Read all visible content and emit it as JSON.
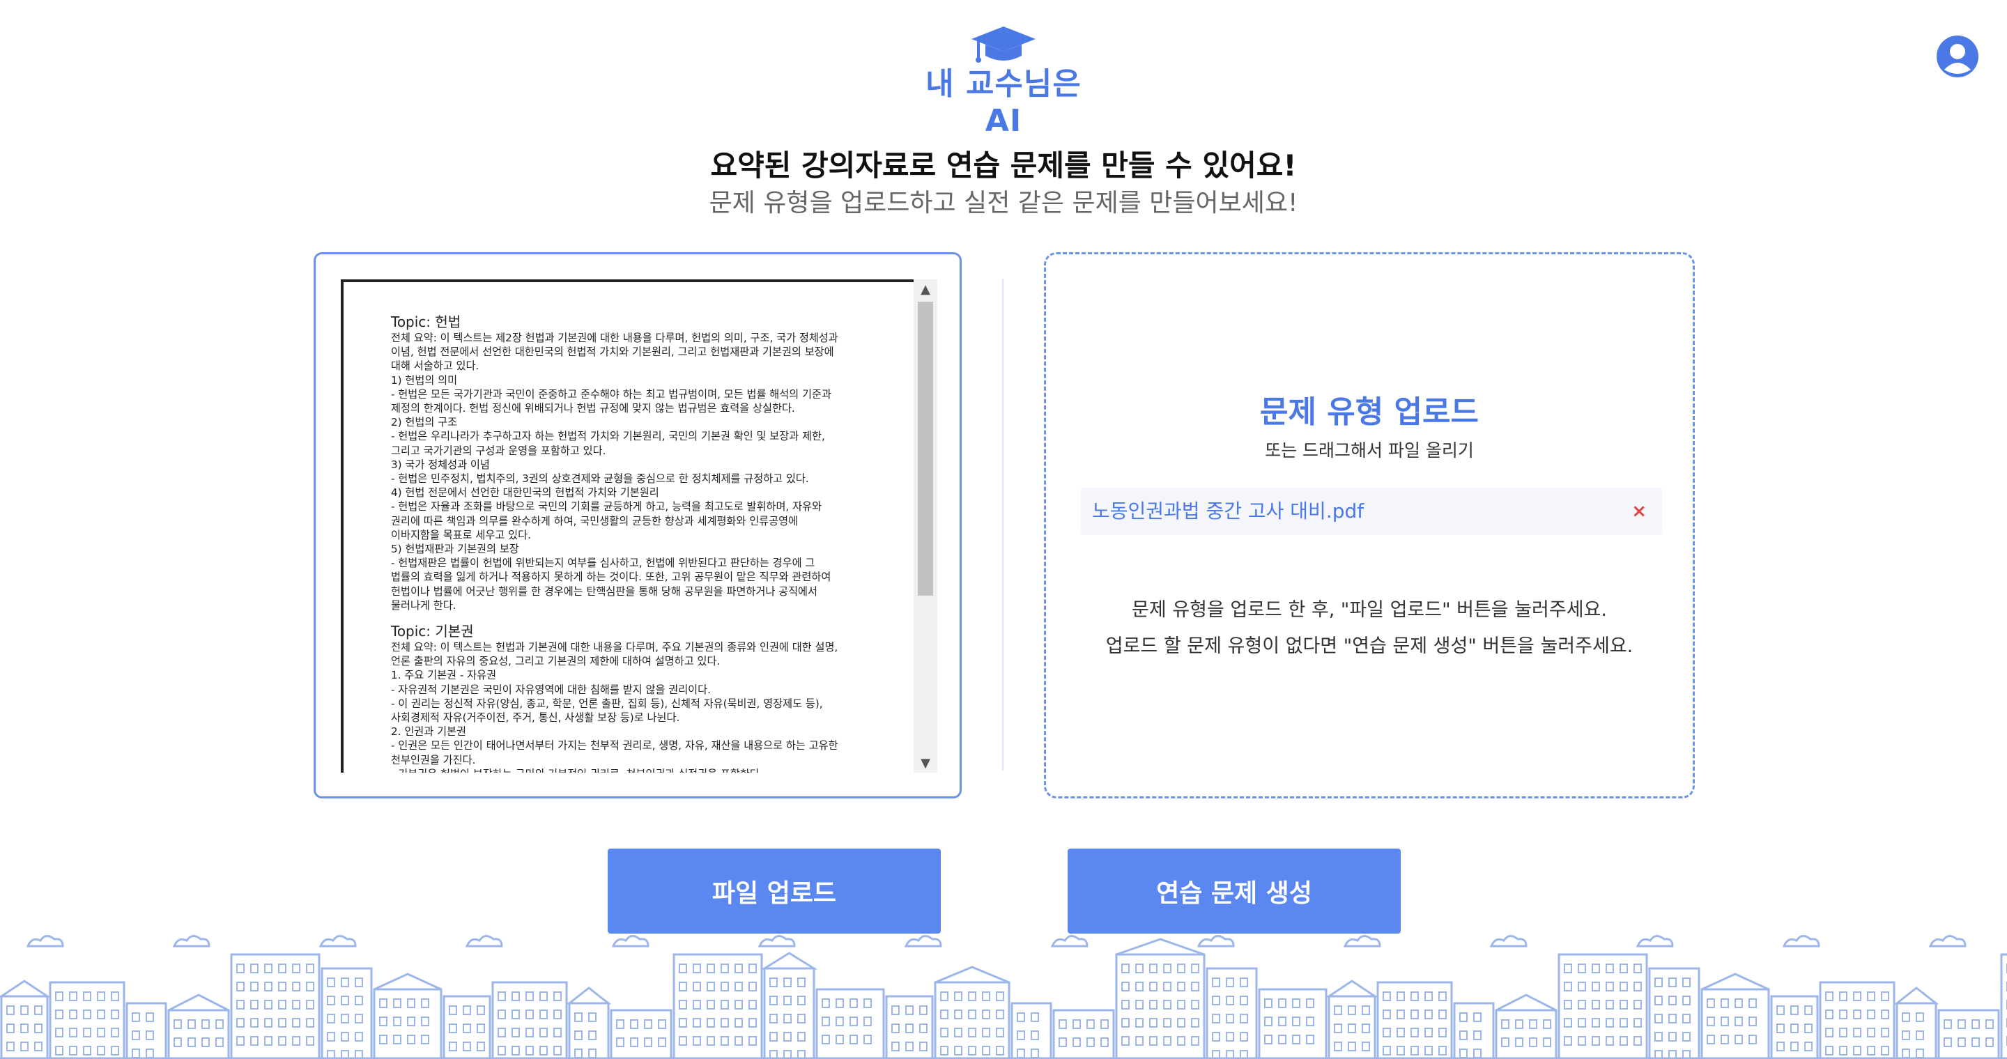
{
  "header": {
    "logo_text": "내 교수님은 AI",
    "logo_icon": "graduation-cap-icon",
    "profile_icon": "user-avatar-icon"
  },
  "intro": {
    "headline": "요약된 강의자료로 연습 문제를 만들 수 있어요!",
    "subhead": "문제 유형을 업로드하고 실전 같은 문제를 만들어보세요!"
  },
  "document": {
    "sections": [
      {
        "topic": "Topic: 헌법",
        "lines": [
          "전체 요약: 이 텍스트는 제2장 헌법과 기본권에 대한 내용을 다루며, 헌법의 의미, 구조, 국가 정체성과",
          "이념, 헌법 전문에서 선언한 대한민국의 헌법적 가치와 기본원리, 그리고 헌법재판과 기본권의 보장에",
          "대해 서술하고 있다.",
          "1) 헌법의 의미",
          "- 헌법은 모든 국가기관과 국민이 준중하고 준수해야 하는 최고 법규범이며, 모든 법률 해석의 기준과",
          "제정의 한계이다. 헌법 정신에 위배되거나 헌법 규정에 맞지 않는 법규범은 효력을 상실한다.",
          "2) 헌법의 구조",
          "- 헌법은 우리나라가 추구하고자 하는 헌법적 가치와 기본원리, 국민의 기본권 확인 및 보장과 제한,",
          "그리고 국가기관의 구성과 운영을 포함하고 있다.",
          "3) 국가 정체성과 이념",
          "- 헌법은 민주정치, 법치주의, 3권의 상호견제와 균형을 중심으로 한 정치체제를 규정하고 있다.",
          "4) 헌법 전문에서 선언한 대한민국의 헌법적 가치와 기본원리",
          "- 헌법은 자율과 조화를 바탕으로 국민의 기회를 균등하게 하고, 능력을 최고도로 발휘하며, 자유와",
          "권리에 따른 책임과 의무를 완수하게 하여, 국민생활의 균등한 향상과 세계평화와 인류공영에",
          "이바지함을 목표로 세우고 있다.",
          "5) 헌법재판과 기본권의 보장",
          "- 헌법재판은 법률이 헌법에 위반되는지 여부를 심사하고, 헌법에 위반된다고 판단하는 경우에 그",
          "법률의 효력을 잃게 하거나 적용하지 못하게 하는 것이다. 또한, 고위 공무원이 맡은 직무와 관련하여",
          "헌법이나 법률에 어긋난 행위를 한 경우에는 탄핵심판을 통해 당해 공무원을 파면하거나 공직에서",
          "물러나게 한다."
        ]
      },
      {
        "topic": "Topic: 기본권",
        "lines": [
          "전체 요약: 이 텍스트는 헌법과 기본권에 대한 내용을 다루며, 주요 기본권의 종류와 인권에 대한 설명,",
          "언론 출판의 자유의 중요성, 그리고 기본권의 제한에 대하여 설명하고 있다.",
          "1. 주요 기본권 - 자유권",
          "- 자유권적 기본권은 국민이 자유영역에 대한 침해를 받지 않을 권리이다.",
          "- 이 권리는 정신적 자유(양심, 종교, 학문, 언론 출판, 집회 등), 신체적 자유(묵비권, 영장제도 등),",
          "사회경제적 자유(거주이전, 주거, 통신, 사생활 보장 등)로 나뉜다.",
          "2. 인권과 기본권",
          "- 인권은 모든 인간이 태어나면서부터 가지는 천부적 권리로, 생명, 자유, 재산을 내용으로 하는 고유한",
          "천부인권을 가진다.",
          "- 기본권은 헌법이 보장하는 국민의 기본적인 권리로, 천부인권과 실정권을 포함한다."
        ]
      }
    ]
  },
  "upload": {
    "title": "문제 유형 업로드",
    "subtitle": "또는 드래그해서 파일 올리기",
    "file_name": "노동인권과법 중간 고사 대비.pdf",
    "remove_label": "×",
    "hint_1": "문제 유형을 업로드 한 후, \"파일 업로드\" 버튼을 눌러주세요.",
    "hint_2": "업로드 할 문제 유형이 없다면 \"연습 문제 생성\" 버튼을 눌러주세요."
  },
  "buttons": {
    "upload_label": "파일 업로드",
    "generate_label": "연습 문제 생성"
  },
  "colors": {
    "accent": "#4a78e5",
    "button": "#5b87f0",
    "remove": "#e0443e",
    "skyline": "#9db6ea"
  }
}
